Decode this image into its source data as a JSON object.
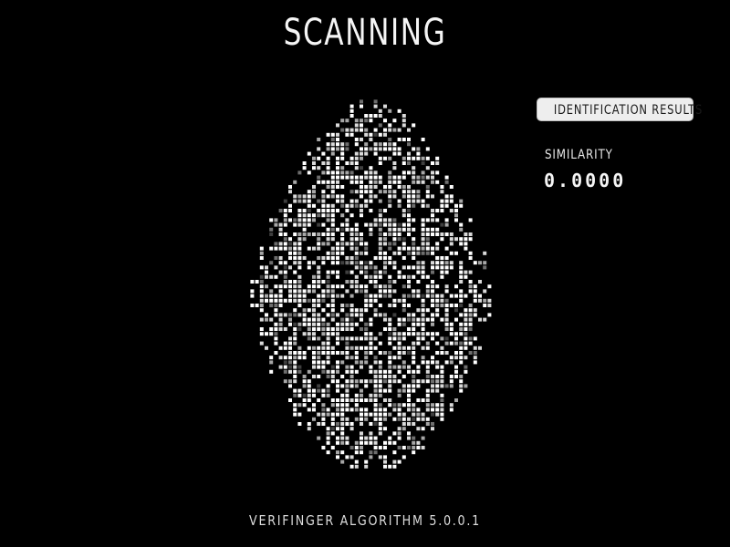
{
  "header": {
    "title": "SCANNING"
  },
  "fingerprint": {
    "icon": "fingerprint-scan-icon",
    "dot_colors": [
      "#ffffff",
      "#d9d9d9",
      "#a6a6a6",
      "#6e6e6e",
      "#3f3f3f"
    ]
  },
  "results": {
    "badge_label": "IDENTIFICATION RESULTS",
    "similarity_label": "SIMILARITY",
    "similarity_value": "0.0000"
  },
  "footer": {
    "version_text": "VERIFINGER ALGORITHM 5.0.0.1"
  }
}
